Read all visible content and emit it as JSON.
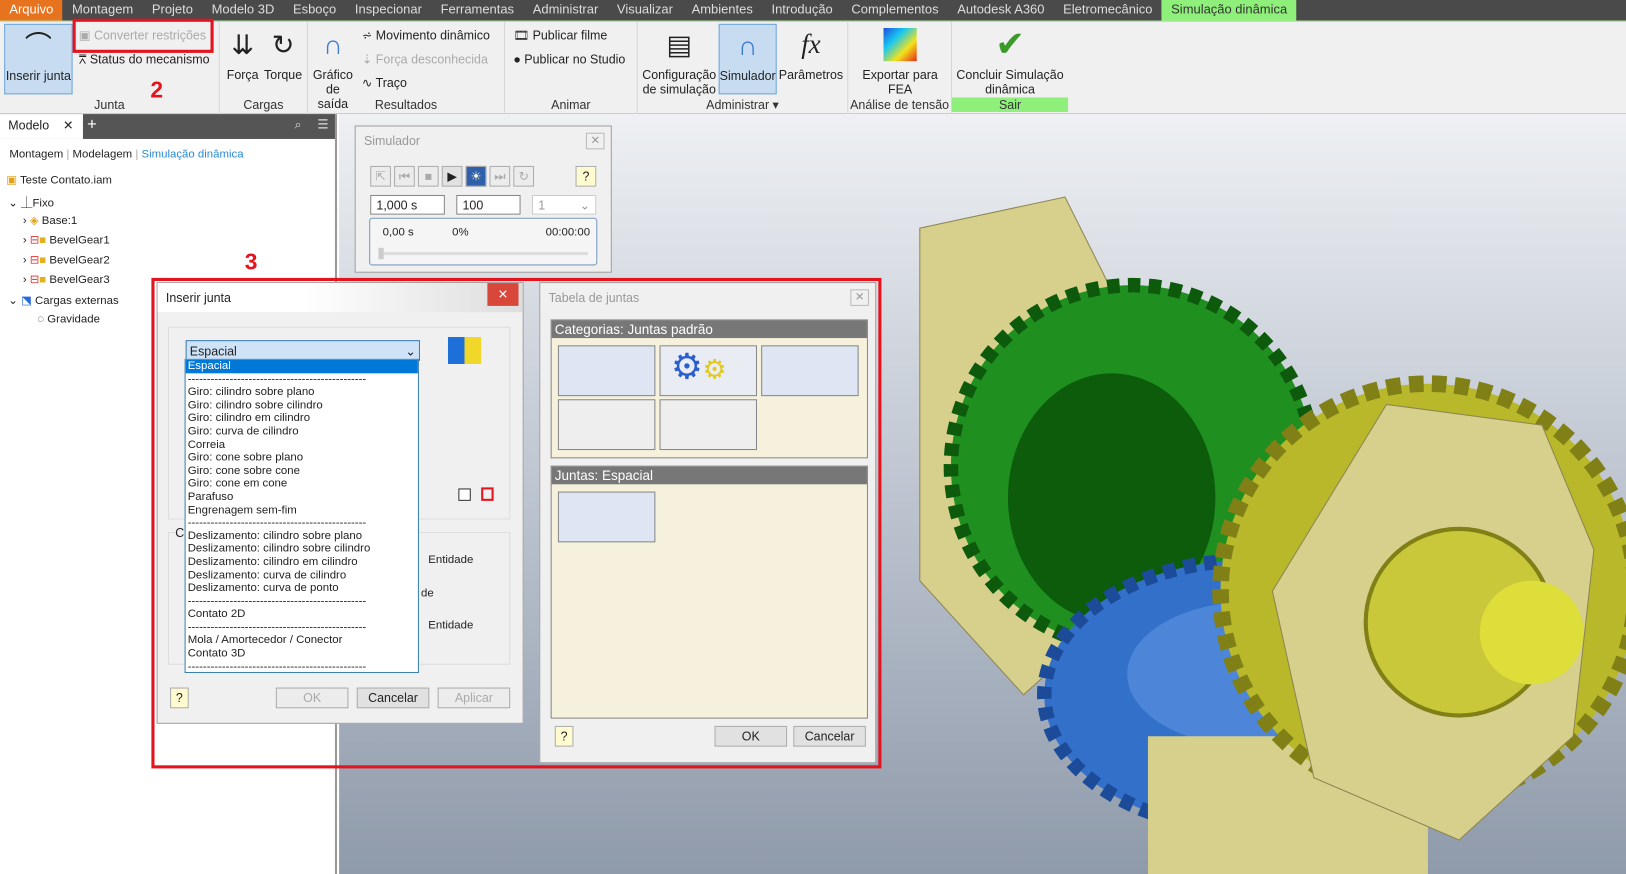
{
  "tabs": [
    "Arquivo",
    "Montagem",
    "Projeto",
    "Modelo 3D",
    "Esboço",
    "Inspecionar",
    "Ferramentas",
    "Administrar",
    "Visualizar",
    "Ambientes",
    "Introdução",
    "Complementos",
    "Autodesk A360",
    "Eletromecânico",
    "Simulação dinâmica"
  ],
  "ribbon": {
    "inserir_junta": "Inserir junta",
    "converter": "Converter restrições",
    "status": "Status do mecanismo",
    "junta": "Junta",
    "forca": "Força",
    "torque": "Torque",
    "cargas": "Cargas",
    "grafico": "Gráfico de saída",
    "movimento": "Movimento dinâmico",
    "forca_desc": "Força desconhecida",
    "traco": "Traço",
    "resultados": "Resultados",
    "publicar_filme": "Publicar filme",
    "publicar_studio": "Publicar no Studio",
    "animar": "Animar",
    "config": "Configuração de simulação",
    "simulador": "Simulador",
    "parametros": "Parâmetros",
    "administrar": "Administrar ▾",
    "exportar": "Exportar para FEA",
    "analise": "Análise de tensão",
    "concluir": "Concluir Simulação dinâmica",
    "sair": "Sair"
  },
  "browser": {
    "tab": "Modelo",
    "modes": [
      "Montagem",
      "Modelagem",
      "Simulação dinâmica"
    ],
    "tree": [
      "Teste Contato.iam",
      "Fixo",
      "Base:1",
      "BevelGear1",
      "BevelGear2",
      "BevelGear3",
      "Cargas externas",
      "Gravidade"
    ]
  },
  "simulator": {
    "title": "Simulador",
    "time": "1,000 s",
    "steps": "100",
    "rate": "1",
    "cur_time": "0,00 s",
    "percent": "0%",
    "clock": "00:00:00",
    "progress": 0
  },
  "insert_joint": {
    "title": "Inserir junta",
    "selected": "Espacial",
    "options": [
      "Espacial",
      "-----------------------------------------------",
      "Giro: cilindro sobre plano",
      "Giro: cilindro sobre cilindro",
      "Giro: cilindro em cilindro",
      "Giro: curva de cilindro",
      "Correia",
      "Giro: cone sobre plano",
      "Giro: cone sobre cone",
      "Giro: cone em cone",
      "Parafuso",
      "Engrenagem sem-fim",
      "-----------------------------------------------",
      "Deslizamento: cilindro sobre plano",
      "Deslizamento: cilindro sobre cilindro",
      "Deslizamento: cilindro em cilindro",
      "Deslizamento: curva de cilindro",
      "Deslizamento: curva de ponto",
      "-----------------------------------------------",
      "Contato 2D",
      "-----------------------------------------------",
      "Mola / Amortecedor / Conector",
      "Contato 3D",
      "-----------------------------------------------"
    ],
    "group_partial": "Co",
    "entity1": "Entidade",
    "entity_partial": "de",
    "entity2": "Entidade",
    "ok": "OK",
    "cancel": "Cancelar",
    "apply": "Aplicar"
  },
  "joint_table": {
    "title": "Tabela de juntas",
    "categories": "Categorias: Juntas padrão",
    "joints": "Juntas: Espacial",
    "ok": "OK",
    "cancel": "Cancelar"
  },
  "annotations": {
    "n2": "2",
    "n3": "3"
  },
  "colors": {
    "accent": "#8ef07a",
    "file": "#e8731f",
    "highlight": "#e3141e"
  }
}
